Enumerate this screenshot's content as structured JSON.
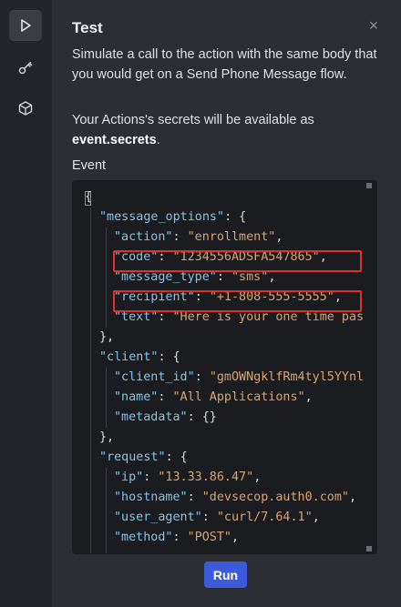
{
  "rail": {
    "items": [
      {
        "name": "play-icon",
        "active": true
      },
      {
        "name": "key-icon",
        "active": false
      },
      {
        "name": "cube-icon",
        "active": false
      }
    ]
  },
  "panel": {
    "title": "Test",
    "close_icon": "×",
    "description": "Simulate a call to the action with the same body that you would get on a Send Phone Message flow.",
    "secrets_prefix": "Your Actions's secrets will be available as",
    "secrets_code": "event.secrets",
    "secrets_suffix": ".",
    "event_label": "Event",
    "run_label": "Run"
  },
  "editor": {
    "lines": [
      {
        "indent": 0,
        "parts": [
          [
            "p",
            "{"
          ]
        ]
      },
      {
        "indent": 1,
        "parts": [
          [
            "k",
            "\"message_options\""
          ],
          [
            "p",
            ": {"
          ]
        ]
      },
      {
        "indent": 2,
        "parts": [
          [
            "k",
            "\"action\""
          ],
          [
            "p",
            ": "
          ],
          [
            "s",
            "\"enrollment\""
          ],
          [
            "p",
            ","
          ]
        ]
      },
      {
        "indent": 2,
        "parts": [
          [
            "k",
            "\"code\""
          ],
          [
            "p",
            ": "
          ],
          [
            "s",
            "\"1234556ADSFA547865\""
          ],
          [
            "p",
            ","
          ]
        ]
      },
      {
        "indent": 2,
        "parts": [
          [
            "k",
            "\"message_type\""
          ],
          [
            "p",
            ": "
          ],
          [
            "s",
            "\"sms\""
          ],
          [
            "p",
            ","
          ]
        ]
      },
      {
        "indent": 2,
        "parts": [
          [
            "k",
            "\"recipient\""
          ],
          [
            "p",
            ": "
          ],
          [
            "s",
            "\"+1-808-555-5555\""
          ],
          [
            "p",
            ","
          ]
        ]
      },
      {
        "indent": 2,
        "parts": [
          [
            "k",
            "\"text\""
          ],
          [
            "p",
            ": "
          ],
          [
            "s",
            "\"Here is your one time pas"
          ]
        ]
      },
      {
        "indent": 1,
        "parts": [
          [
            "p",
            "},"
          ]
        ]
      },
      {
        "indent": 1,
        "parts": [
          [
            "k",
            "\"client\""
          ],
          [
            "p",
            ": {"
          ]
        ]
      },
      {
        "indent": 2,
        "parts": [
          [
            "k",
            "\"client_id\""
          ],
          [
            "p",
            ": "
          ],
          [
            "s",
            "\"gmOWNgklfRm4tyl5YYnl"
          ]
        ]
      },
      {
        "indent": 2,
        "parts": [
          [
            "k",
            "\"name\""
          ],
          [
            "p",
            ": "
          ],
          [
            "s",
            "\"All Applications\""
          ],
          [
            "p",
            ","
          ]
        ]
      },
      {
        "indent": 2,
        "parts": [
          [
            "k",
            "\"metadata\""
          ],
          [
            "p",
            ": {}"
          ]
        ]
      },
      {
        "indent": 1,
        "parts": [
          [
            "p",
            "},"
          ]
        ]
      },
      {
        "indent": 1,
        "parts": [
          [
            "k",
            "\"request\""
          ],
          [
            "p",
            ": {"
          ]
        ]
      },
      {
        "indent": 2,
        "parts": [
          [
            "k",
            "\"ip\""
          ],
          [
            "p",
            ": "
          ],
          [
            "s",
            "\"13.33.86.47\""
          ],
          [
            "p",
            ","
          ]
        ]
      },
      {
        "indent": 2,
        "parts": [
          [
            "k",
            "\"hostname\""
          ],
          [
            "p",
            ": "
          ],
          [
            "s",
            "\"devsecop.auth0.com\""
          ],
          [
            "p",
            ","
          ]
        ]
      },
      {
        "indent": 2,
        "parts": [
          [
            "k",
            "\"user_agent\""
          ],
          [
            "p",
            ": "
          ],
          [
            "s",
            "\"curl/7.64.1\""
          ],
          [
            "p",
            ","
          ]
        ]
      },
      {
        "indent": 2,
        "parts": [
          [
            "k",
            "\"method\""
          ],
          [
            "p",
            ": "
          ],
          [
            "s",
            "\"POST\""
          ],
          [
            "p",
            ","
          ]
        ]
      }
    ],
    "highlighted_lines": [
      3,
      5
    ]
  },
  "colors": {
    "key": "#7ec5e8",
    "string": "#d7a46f",
    "highlight_box": "#e1312c",
    "run_button": "#3b5bdb"
  }
}
